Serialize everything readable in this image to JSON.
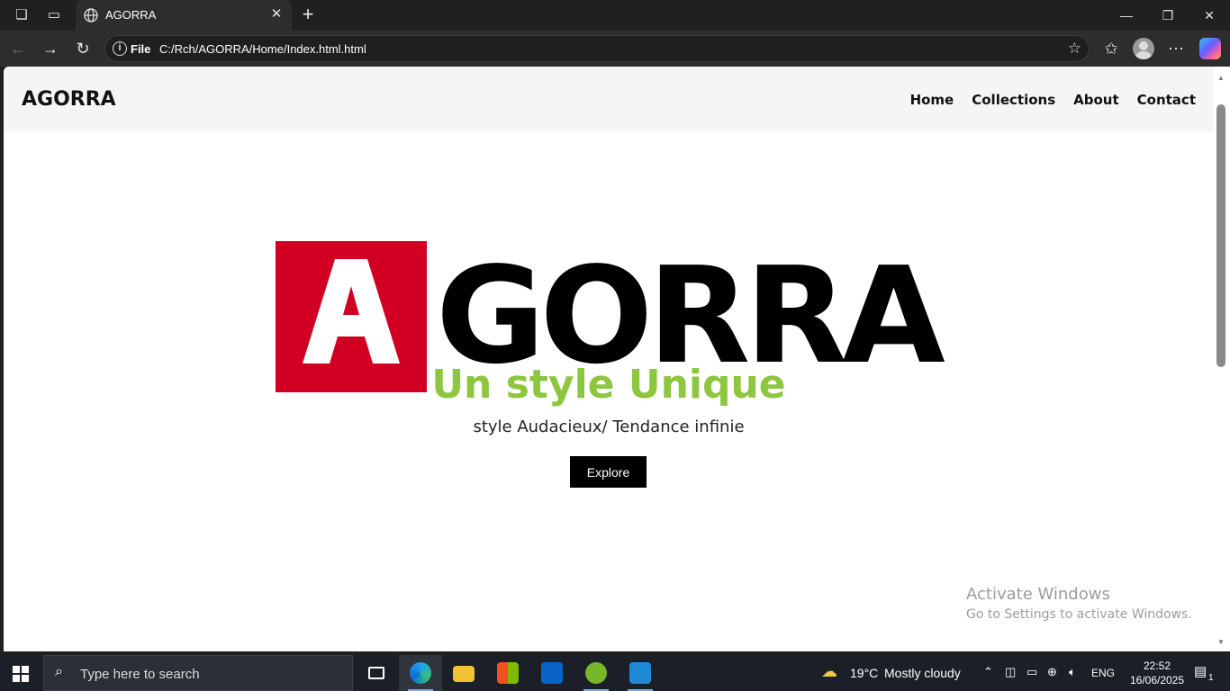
{
  "browser": {
    "tab_title": "AGORRA",
    "scheme_label": "File",
    "url": "C:/Rch/AGORRA/Home/Index.html.html"
  },
  "site": {
    "brand": "AGORRA",
    "nav": [
      "Home",
      "Collections",
      "About",
      "Contact"
    ],
    "logo_letter": "A",
    "logo_word": "GORRA",
    "hero_title": "Un style Unique",
    "hero_subtitle": "style Audacieux/ Tendance infinie",
    "cta_label": "Explore"
  },
  "watermark": {
    "line1": "Activate Windows",
    "line2": "Go to Settings to activate Windows."
  },
  "taskbar": {
    "search_placeholder": "Type here to search",
    "weather_temp": "19°C",
    "weather_desc": "Mostly cloudy",
    "language": "ENG",
    "time": "22:52",
    "date": "16/06/2025",
    "notification_count": "1"
  },
  "colors": {
    "brand_red": "#d10023",
    "hero_green": "#8dc63f"
  }
}
